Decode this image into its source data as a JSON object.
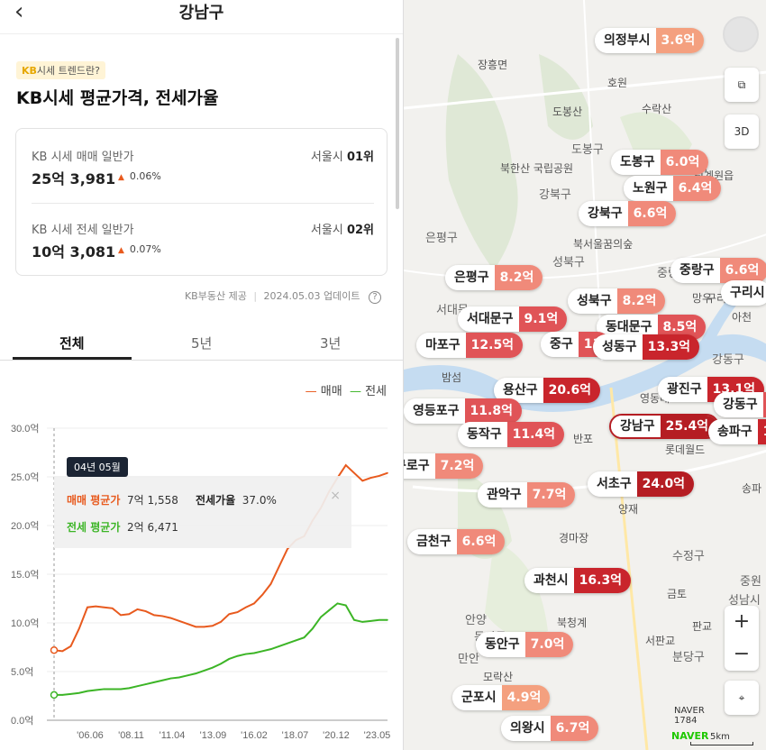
{
  "header": {
    "title": "강남구",
    "back_icon": "chevron-left-icon"
  },
  "intro": {
    "badge_kb": "KB",
    "badge_text": "시세 트렌드란?",
    "heading": "KB시세 평균가격, 전세가율"
  },
  "sale": {
    "label": "KB 시세 매매 일반가",
    "value": "25억 3,981",
    "change": "0.06%",
    "rank_prefix": "서울시",
    "rank": "01위"
  },
  "jeonse": {
    "label": "KB 시세 전세 일반가",
    "value": "10억 3,081",
    "change": "0.07%",
    "rank_prefix": "서울시",
    "rank": "02위"
  },
  "source": {
    "provider": "KB부동산 제공",
    "updated": "2024.05.03 업데이트",
    "info_icon": "?"
  },
  "tabs": [
    {
      "label": "전체",
      "active": true
    },
    {
      "label": "5년",
      "active": false
    },
    {
      "label": "3년",
      "active": false
    }
  ],
  "legend": {
    "sale": "매매",
    "jeonse": "전세"
  },
  "tooltip": {
    "date": "04년 05월",
    "sale_label": "매매 평균가",
    "sale_value": "7억 1,558",
    "ratio_label": "전세가율",
    "ratio_value": "37.0%",
    "jeonse_label": "전세 평균가",
    "jeonse_value": "2억 6,471",
    "close": "×"
  },
  "chart_data": {
    "type": "line",
    "x": [
      "04.05",
      "05.01",
      "05.06",
      "06.01",
      "06.06",
      "07.01",
      "07.06",
      "08.01",
      "08.06",
      "08.11",
      "09.06",
      "10.01",
      "10.06",
      "11.01",
      "11.04",
      "12.01",
      "12.06",
      "13.01",
      "13.06",
      "13.09",
      "14.06",
      "15.01",
      "15.06",
      "16.02",
      "16.06",
      "17.01",
      "17.06",
      "18.01",
      "18.07",
      "19.01",
      "19.06",
      "20.01",
      "20.06",
      "20.12",
      "21.06",
      "22.01",
      "22.06",
      "23.01",
      "23.05",
      "24.01",
      "24.05"
    ],
    "series": [
      {
        "name": "매매",
        "color": "#e85a1e",
        "values": [
          7.2,
          7.1,
          7.6,
          9.4,
          11.6,
          11.7,
          11.6,
          11.5,
          10.8,
          10.9,
          11.4,
          11.2,
          10.8,
          10.7,
          10.5,
          10.2,
          9.9,
          9.6,
          9.6,
          9.7,
          10.1,
          10.9,
          11.1,
          11.6,
          12.0,
          12.9,
          14.0,
          15.8,
          17.6,
          18.5,
          18.9,
          20.5,
          21.8,
          23.5,
          24.9,
          26.2,
          25.4,
          24.6,
          24.9,
          25.1,
          25.4
        ]
      },
      {
        "name": "전세",
        "color": "#3cb526",
        "values": [
          2.6,
          2.6,
          2.7,
          2.8,
          3.0,
          3.1,
          3.2,
          3.2,
          3.2,
          3.3,
          3.5,
          3.7,
          3.9,
          4.1,
          4.3,
          4.4,
          4.6,
          4.8,
          5.1,
          5.4,
          5.8,
          6.3,
          6.6,
          6.8,
          6.9,
          7.1,
          7.3,
          7.6,
          7.9,
          8.2,
          8.5,
          9.4,
          10.6,
          11.3,
          12.0,
          11.8,
          10.3,
          10.1,
          10.2,
          10.3,
          10.3
        ]
      }
    ],
    "y_ticks": [
      "0.0억",
      "5.0억",
      "10.0억",
      "15.0억",
      "20.0억",
      "25.0억",
      "30.0억"
    ],
    "x_ticks": [
      "'06.06",
      "'08.11",
      "'11.04",
      "'13.09",
      "'16.02",
      "'18.07",
      "'20.12",
      "'23.05"
    ],
    "ylim": [
      0,
      30
    ],
    "grid": true
  },
  "map": {
    "pins": [
      {
        "name": "의정부시",
        "pct": "3.6억",
        "cls": "p2"
      },
      {
        "name": "도봉구",
        "pct": "6.0억",
        "cls": "p1"
      },
      {
        "name": "노원구",
        "pct": "6.4억",
        "cls": "p1"
      },
      {
        "name": "강북구",
        "pct": "6.6억",
        "cls": "p1"
      },
      {
        "name": "은평구",
        "pct": "8.2억",
        "cls": "p1"
      },
      {
        "name": "성북구",
        "pct": "8.2억",
        "cls": "p1"
      },
      {
        "name": "중랑구",
        "pct": "6.6억",
        "cls": "p1"
      },
      {
        "name": "서대문구",
        "pct": "9.1억",
        "cls": "p3"
      },
      {
        "name": "동대문구",
        "pct": "8.5억",
        "cls": "p3"
      },
      {
        "name": "마포구",
        "pct": "12.5억",
        "cls": "p3"
      },
      {
        "name": "중구",
        "pct": "11",
        "cls": "p3"
      },
      {
        "name": "성동구",
        "pct": "13.3억",
        "cls": "p4"
      },
      {
        "name": "용산구",
        "pct": "20.6억",
        "cls": "p4"
      },
      {
        "name": "광진구",
        "pct": "13.1억",
        "cls": "p4"
      },
      {
        "name": "영등포구",
        "pct": "11.8억",
        "cls": "p3"
      },
      {
        "name": "강남구",
        "pct": "25.4억",
        "cls": "p5"
      },
      {
        "name": "동작구",
        "pct": "11.4억",
        "cls": "p3"
      },
      {
        "name": "강동구",
        "pct": "",
        "cls": "p3"
      },
      {
        "name": "송파구",
        "pct": "17.3",
        "cls": "p4"
      },
      {
        "name": "구로구",
        "pct": "7.2억",
        "cls": "p1"
      },
      {
        "name": "관악구",
        "pct": "7.7억",
        "cls": "p1"
      },
      {
        "name": "서초구",
        "pct": "24.0억",
        "cls": "p5"
      },
      {
        "name": "금천구",
        "pct": "6.6억",
        "cls": "p1"
      },
      {
        "name": "과천시",
        "pct": "16.3억",
        "cls": "p4"
      },
      {
        "name": "동안구",
        "pct": "7.0억",
        "cls": "p1"
      },
      {
        "name": "군포시",
        "pct": "4.9억",
        "cls": "p2"
      },
      {
        "name": "의왕시",
        "pct": "6.7억",
        "cls": "p1"
      },
      {
        "name": "구리시",
        "pct": "",
        "cls": "p1"
      }
    ],
    "labels": [
      "장흥면",
      "호원",
      "도봉산",
      "수락산",
      "북한산 국립공원",
      "도봉구",
      "별내",
      "퇴계원읍",
      "강북구",
      "은평구",
      "북서울꿈의숲",
      "성북구",
      "중랑",
      "서대문",
      "망우",
      "구리",
      "아천",
      "밤섬",
      "반포",
      "영동대교",
      "강동구",
      "롯데월드",
      "송파",
      "반포",
      "양재",
      "경마장",
      "수정구",
      "금토",
      "판교",
      "북청계",
      "서판교",
      "분당구",
      "중원",
      "성남시",
      "안양",
      "만안",
      "모락산",
      "동안구"
    ],
    "buttons": {
      "three_d": "3D"
    },
    "footer": {
      "naver": "NAVER",
      "scale": "5km",
      "stamp": "1784"
    }
  }
}
